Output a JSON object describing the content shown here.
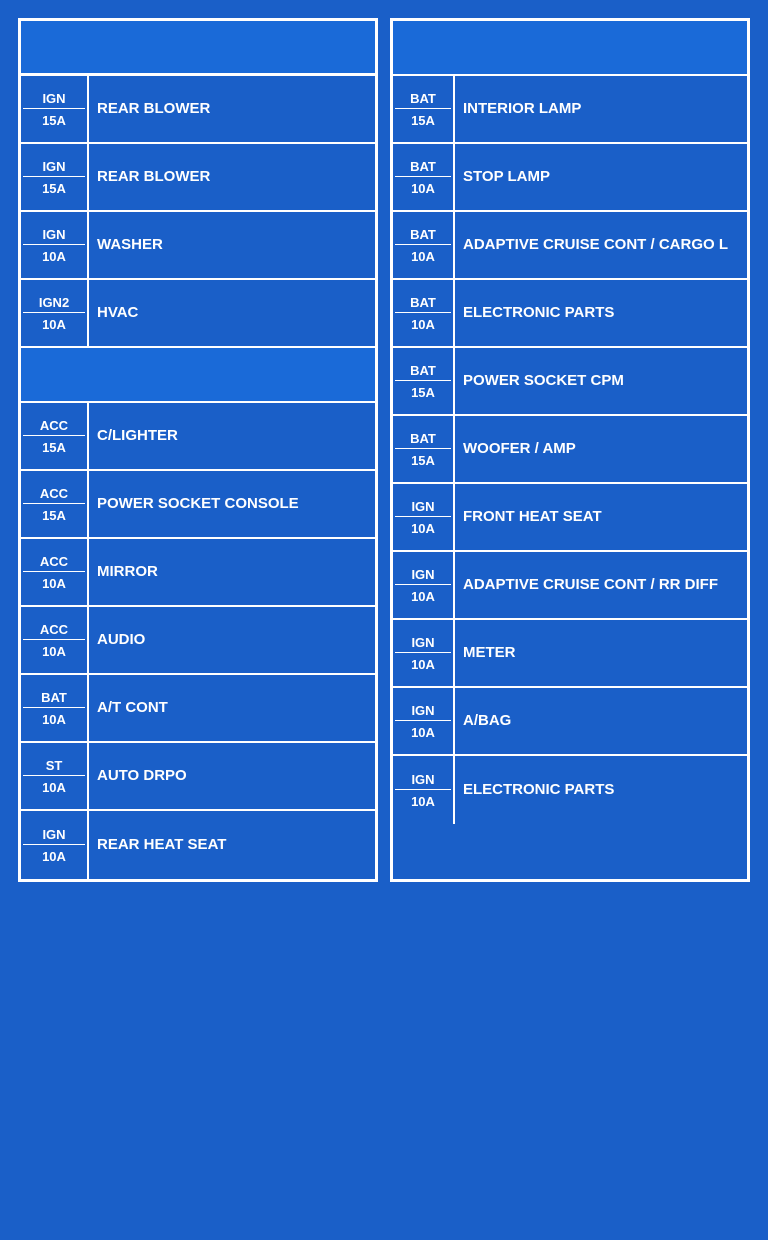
{
  "left_column": {
    "rows": [
      {
        "code_top": "IGN",
        "code_bottom": "15A",
        "description": "REAR BLOWER"
      },
      {
        "code_top": "IGN",
        "code_bottom": "15A",
        "description": "REAR BLOWER"
      },
      {
        "code_top": "IGN",
        "code_bottom": "10A",
        "description": "WASHER"
      },
      {
        "code_top": "IGN2",
        "code_bottom": "10A",
        "description": "HVAC"
      },
      {
        "spacer": true
      },
      {
        "code_top": "ACC",
        "code_bottom": "15A",
        "description": "C/LIGHTER"
      },
      {
        "code_top": "ACC",
        "code_bottom": "15A",
        "description": "POWER SOCKET CONSOLE"
      },
      {
        "code_top": "ACC",
        "code_bottom": "10A",
        "description": "MIRROR"
      },
      {
        "code_top": "ACC",
        "code_bottom": "10A",
        "description": "AUDIO"
      },
      {
        "code_top": "BAT",
        "code_bottom": "10A",
        "description": "A/T CONT"
      },
      {
        "code_top": "ST",
        "code_bottom": "10A",
        "description": "AUTO DRPO"
      },
      {
        "code_top": "IGN",
        "code_bottom": "10A",
        "description": "REAR HEAT SEAT"
      }
    ]
  },
  "right_column": {
    "rows": [
      {
        "spacer": true
      },
      {
        "code_top": "BAT",
        "code_bottom": "15A",
        "description": "INTERIOR LAMP"
      },
      {
        "code_top": "BAT",
        "code_bottom": "10A",
        "description": "STOP LAMP"
      },
      {
        "code_top": "BAT",
        "code_bottom": "10A",
        "description": "ADAPTIVE CRUISE CONT / CARGO L"
      },
      {
        "code_top": "BAT",
        "code_bottom": "10A",
        "description": "ELECTRONIC PARTS"
      },
      {
        "code_top": "BAT",
        "code_bottom": "15A",
        "description": "POWER SOCKET CPM"
      },
      {
        "code_top": "BAT",
        "code_bottom": "15A",
        "description": "WOOFER / AMP"
      },
      {
        "code_top": "IGN",
        "code_bottom": "10A",
        "description": "FRONT HEAT SEAT"
      },
      {
        "code_top": "IGN",
        "code_bottom": "10A",
        "description": "ADAPTIVE CRUISE CONT / RR DIFF"
      },
      {
        "code_top": "IGN",
        "code_bottom": "10A",
        "description": "METER"
      },
      {
        "code_top": "IGN",
        "code_bottom": "10A",
        "description": "A/BAG"
      },
      {
        "code_top": "IGN",
        "code_bottom": "10A",
        "description": "ELECTRONIC PARTS"
      }
    ]
  }
}
